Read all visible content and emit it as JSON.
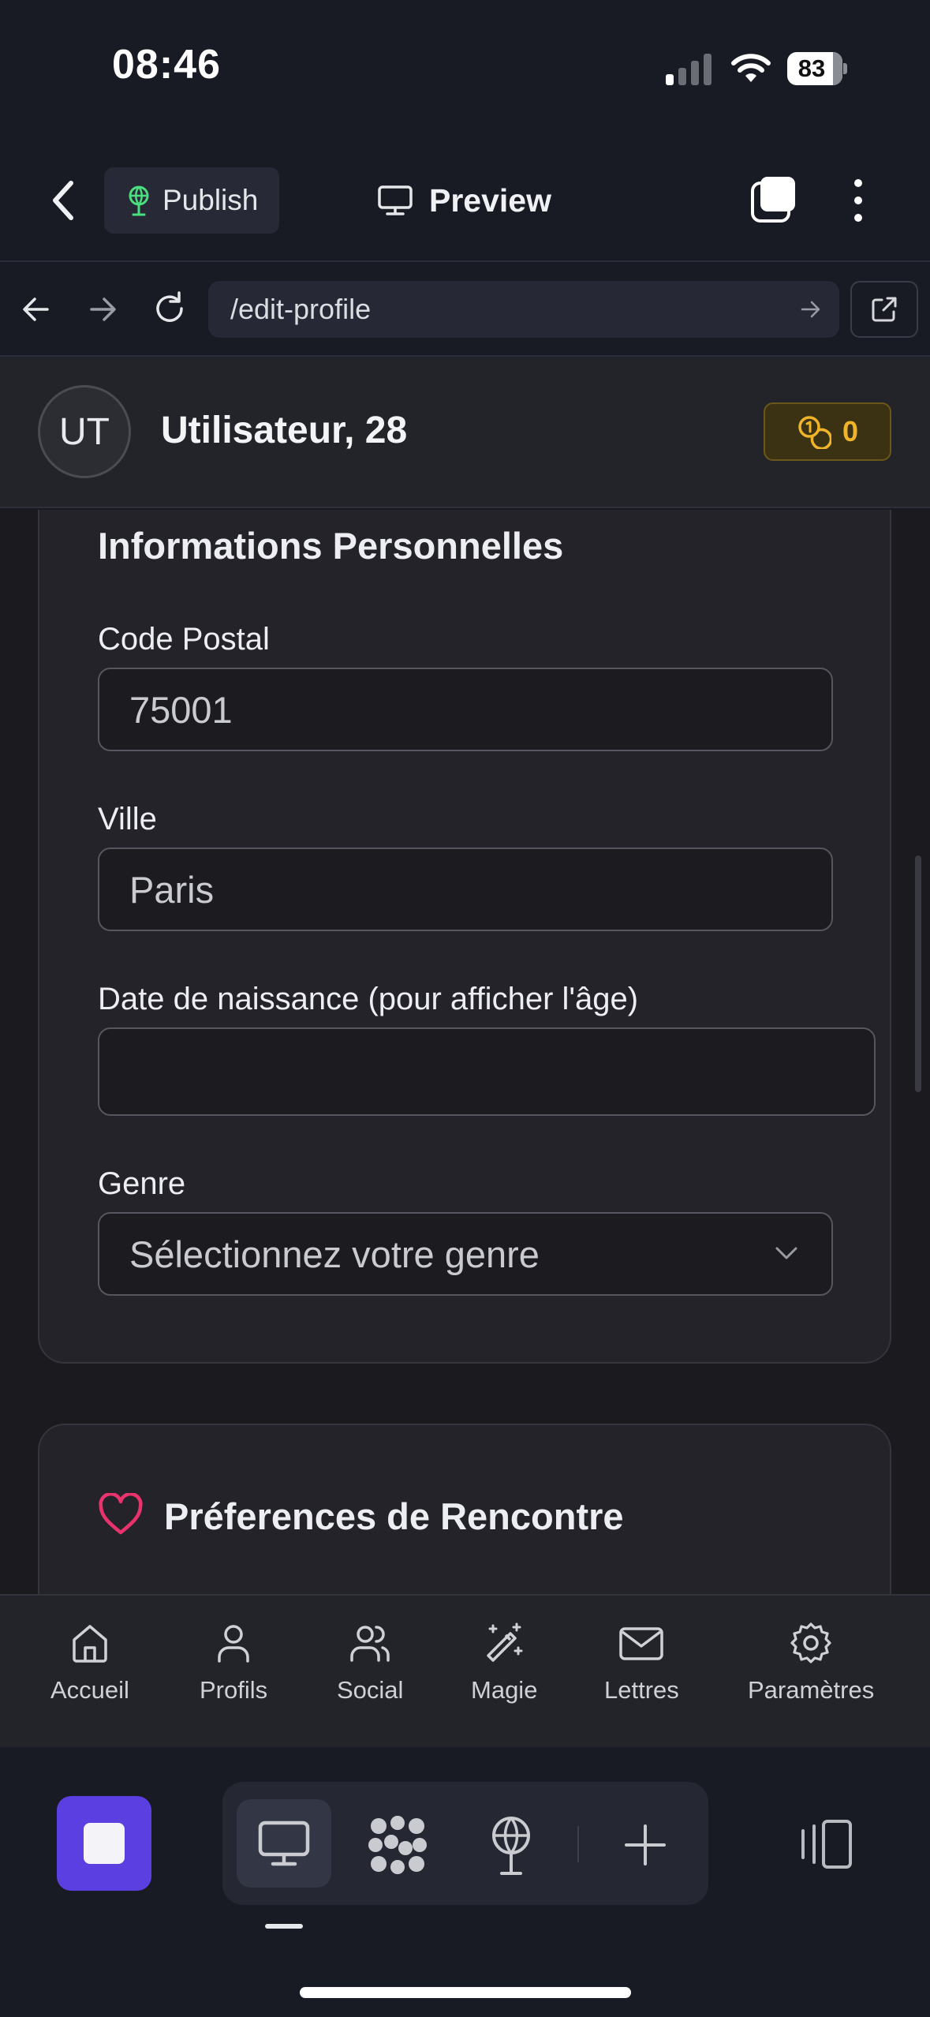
{
  "status_bar": {
    "time": "08:46",
    "battery": "83"
  },
  "top_bar": {
    "publish_label": "Publish",
    "preview_label": "Preview"
  },
  "url_bar": {
    "url": "/edit-profile"
  },
  "profile": {
    "initials": "UT",
    "name": "Utilisateur, 28",
    "coins": "0"
  },
  "personal_info": {
    "title": "Informations Personnelles",
    "postal_code": {
      "label": "Code Postal",
      "value": "75001"
    },
    "city": {
      "label": "Ville",
      "value": "Paris"
    },
    "birthdate": {
      "label": "Date de naissance (pour afficher l'âge)",
      "value": ""
    },
    "gender": {
      "label": "Genre",
      "placeholder": "Sélectionnez votre genre"
    }
  },
  "preferences": {
    "title": "Préferences de Rencontre",
    "icon": "heart-icon",
    "accent": "#e8336d"
  },
  "bottom_nav": {
    "items": [
      {
        "label": "Accueil",
        "icon": "home-icon"
      },
      {
        "label": "Profils",
        "icon": "user-icon"
      },
      {
        "label": "Social",
        "icon": "users-icon"
      },
      {
        "label": "Magie",
        "icon": "magic-wand-icon"
      },
      {
        "label": "Lettres",
        "icon": "mail-icon"
      },
      {
        "label": "Paramètres",
        "icon": "gear-icon"
      }
    ]
  },
  "colors": {
    "background": "#181a24",
    "stop_button": "#5b3fe0",
    "coin_badge": "#f0b429",
    "publish_icon": "#4ade80"
  }
}
